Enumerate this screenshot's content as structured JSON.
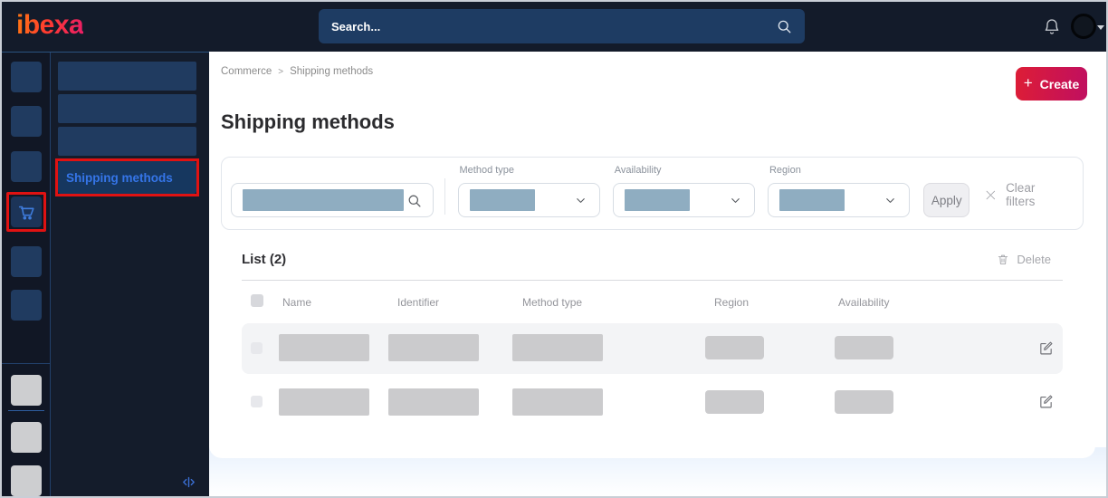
{
  "topbar": {
    "logo_text": "ibexa",
    "search": {
      "placeholder": "Search...",
      "icon": "magnifier"
    },
    "notifications_icon": "bell",
    "user_menu": {
      "avatar": "empty-circle",
      "icon": "caret-down"
    }
  },
  "icon_rail": {
    "active_icon": "shopping-cart",
    "active_highlight": "red-border"
  },
  "side_panel": {
    "active_item_label": "Shipping methods",
    "collapse_icon": "code-collapse"
  },
  "breadcrumb": {
    "items": [
      "Commerce",
      "Shipping methods"
    ],
    "separator": ">"
  },
  "header": {
    "title": "Shipping methods",
    "create_button": {
      "plus": "+",
      "label": "Create"
    }
  },
  "filters": {
    "search_field": {
      "value_redacted": true
    },
    "dropdowns": [
      {
        "label": "Method type",
        "value_redacted": true
      },
      {
        "label": "Availability",
        "value_redacted": true
      },
      {
        "label": "Region",
        "value_redacted": true
      }
    ],
    "apply_label": "Apply",
    "clear_filters_label": "Clear filters"
  },
  "list": {
    "title": "List (2)",
    "count": 2,
    "delete_label": "Delete",
    "columns": [
      "Name",
      "Identifier",
      "Method type",
      "Region",
      "Availability"
    ],
    "rows": [
      {
        "redacted": true
      },
      {
        "redacted": true
      }
    ]
  },
  "colors": {
    "topbar_bg": "#131b2a",
    "topbar_search_bg": "#1e3c63",
    "sidebar_tile": "#203b60",
    "highlight_border": "#e01212",
    "active_link": "#3575e8",
    "create_gradient_start": "#dd1d36",
    "create_gradient_end": "#c00f60",
    "redaction_fill": "#8fadc1",
    "placeholder_fill": "#cbcbcd",
    "row_stripe": "#f3f4f6"
  }
}
